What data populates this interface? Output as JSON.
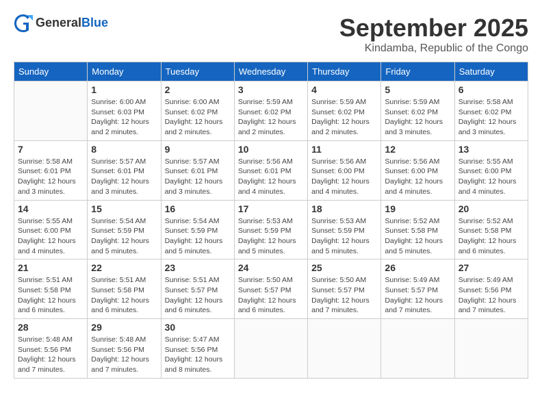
{
  "header": {
    "logo_line1": "General",
    "logo_line2": "Blue",
    "month_title": "September 2025",
    "location": "Kindamba, Republic of the Congo"
  },
  "weekdays": [
    "Sunday",
    "Monday",
    "Tuesday",
    "Wednesday",
    "Thursday",
    "Friday",
    "Saturday"
  ],
  "weeks": [
    [
      {
        "day": "",
        "sunrise": "",
        "sunset": "",
        "daylight": ""
      },
      {
        "day": "1",
        "sunrise": "Sunrise: 6:00 AM",
        "sunset": "Sunset: 6:03 PM",
        "daylight": "Daylight: 12 hours and 2 minutes."
      },
      {
        "day": "2",
        "sunrise": "Sunrise: 6:00 AM",
        "sunset": "Sunset: 6:02 PM",
        "daylight": "Daylight: 12 hours and 2 minutes."
      },
      {
        "day": "3",
        "sunrise": "Sunrise: 5:59 AM",
        "sunset": "Sunset: 6:02 PM",
        "daylight": "Daylight: 12 hours and 2 minutes."
      },
      {
        "day": "4",
        "sunrise": "Sunrise: 5:59 AM",
        "sunset": "Sunset: 6:02 PM",
        "daylight": "Daylight: 12 hours and 2 minutes."
      },
      {
        "day": "5",
        "sunrise": "Sunrise: 5:59 AM",
        "sunset": "Sunset: 6:02 PM",
        "daylight": "Daylight: 12 hours and 3 minutes."
      },
      {
        "day": "6",
        "sunrise": "Sunrise: 5:58 AM",
        "sunset": "Sunset: 6:02 PM",
        "daylight": "Daylight: 12 hours and 3 minutes."
      }
    ],
    [
      {
        "day": "7",
        "sunrise": "Sunrise: 5:58 AM",
        "sunset": "Sunset: 6:01 PM",
        "daylight": "Daylight: 12 hours and 3 minutes."
      },
      {
        "day": "8",
        "sunrise": "Sunrise: 5:57 AM",
        "sunset": "Sunset: 6:01 PM",
        "daylight": "Daylight: 12 hours and 3 minutes."
      },
      {
        "day": "9",
        "sunrise": "Sunrise: 5:57 AM",
        "sunset": "Sunset: 6:01 PM",
        "daylight": "Daylight: 12 hours and 3 minutes."
      },
      {
        "day": "10",
        "sunrise": "Sunrise: 5:56 AM",
        "sunset": "Sunset: 6:01 PM",
        "daylight": "Daylight: 12 hours and 4 minutes."
      },
      {
        "day": "11",
        "sunrise": "Sunrise: 5:56 AM",
        "sunset": "Sunset: 6:00 PM",
        "daylight": "Daylight: 12 hours and 4 minutes."
      },
      {
        "day": "12",
        "sunrise": "Sunrise: 5:56 AM",
        "sunset": "Sunset: 6:00 PM",
        "daylight": "Daylight: 12 hours and 4 minutes."
      },
      {
        "day": "13",
        "sunrise": "Sunrise: 5:55 AM",
        "sunset": "Sunset: 6:00 PM",
        "daylight": "Daylight: 12 hours and 4 minutes."
      }
    ],
    [
      {
        "day": "14",
        "sunrise": "Sunrise: 5:55 AM",
        "sunset": "Sunset: 6:00 PM",
        "daylight": "Daylight: 12 hours and 4 minutes."
      },
      {
        "day": "15",
        "sunrise": "Sunrise: 5:54 AM",
        "sunset": "Sunset: 5:59 PM",
        "daylight": "Daylight: 12 hours and 5 minutes."
      },
      {
        "day": "16",
        "sunrise": "Sunrise: 5:54 AM",
        "sunset": "Sunset: 5:59 PM",
        "daylight": "Daylight: 12 hours and 5 minutes."
      },
      {
        "day": "17",
        "sunrise": "Sunrise: 5:53 AM",
        "sunset": "Sunset: 5:59 PM",
        "daylight": "Daylight: 12 hours and 5 minutes."
      },
      {
        "day": "18",
        "sunrise": "Sunrise: 5:53 AM",
        "sunset": "Sunset: 5:59 PM",
        "daylight": "Daylight: 12 hours and 5 minutes."
      },
      {
        "day": "19",
        "sunrise": "Sunrise: 5:52 AM",
        "sunset": "Sunset: 5:58 PM",
        "daylight": "Daylight: 12 hours and 5 minutes."
      },
      {
        "day": "20",
        "sunrise": "Sunrise: 5:52 AM",
        "sunset": "Sunset: 5:58 PM",
        "daylight": "Daylight: 12 hours and 6 minutes."
      }
    ],
    [
      {
        "day": "21",
        "sunrise": "Sunrise: 5:51 AM",
        "sunset": "Sunset: 5:58 PM",
        "daylight": "Daylight: 12 hours and 6 minutes."
      },
      {
        "day": "22",
        "sunrise": "Sunrise: 5:51 AM",
        "sunset": "Sunset: 5:58 PM",
        "daylight": "Daylight: 12 hours and 6 minutes."
      },
      {
        "day": "23",
        "sunrise": "Sunrise: 5:51 AM",
        "sunset": "Sunset: 5:57 PM",
        "daylight": "Daylight: 12 hours and 6 minutes."
      },
      {
        "day": "24",
        "sunrise": "Sunrise: 5:50 AM",
        "sunset": "Sunset: 5:57 PM",
        "daylight": "Daylight: 12 hours and 6 minutes."
      },
      {
        "day": "25",
        "sunrise": "Sunrise: 5:50 AM",
        "sunset": "Sunset: 5:57 PM",
        "daylight": "Daylight: 12 hours and 7 minutes."
      },
      {
        "day": "26",
        "sunrise": "Sunrise: 5:49 AM",
        "sunset": "Sunset: 5:57 PM",
        "daylight": "Daylight: 12 hours and 7 minutes."
      },
      {
        "day": "27",
        "sunrise": "Sunrise: 5:49 AM",
        "sunset": "Sunset: 5:56 PM",
        "daylight": "Daylight: 12 hours and 7 minutes."
      }
    ],
    [
      {
        "day": "28",
        "sunrise": "Sunrise: 5:48 AM",
        "sunset": "Sunset: 5:56 PM",
        "daylight": "Daylight: 12 hours and 7 minutes."
      },
      {
        "day": "29",
        "sunrise": "Sunrise: 5:48 AM",
        "sunset": "Sunset: 5:56 PM",
        "daylight": "Daylight: 12 hours and 7 minutes."
      },
      {
        "day": "30",
        "sunrise": "Sunrise: 5:47 AM",
        "sunset": "Sunset: 5:56 PM",
        "daylight": "Daylight: 12 hours and 8 minutes."
      },
      {
        "day": "",
        "sunrise": "",
        "sunset": "",
        "daylight": ""
      },
      {
        "day": "",
        "sunrise": "",
        "sunset": "",
        "daylight": ""
      },
      {
        "day": "",
        "sunrise": "",
        "sunset": "",
        "daylight": ""
      },
      {
        "day": "",
        "sunrise": "",
        "sunset": "",
        "daylight": ""
      }
    ]
  ]
}
